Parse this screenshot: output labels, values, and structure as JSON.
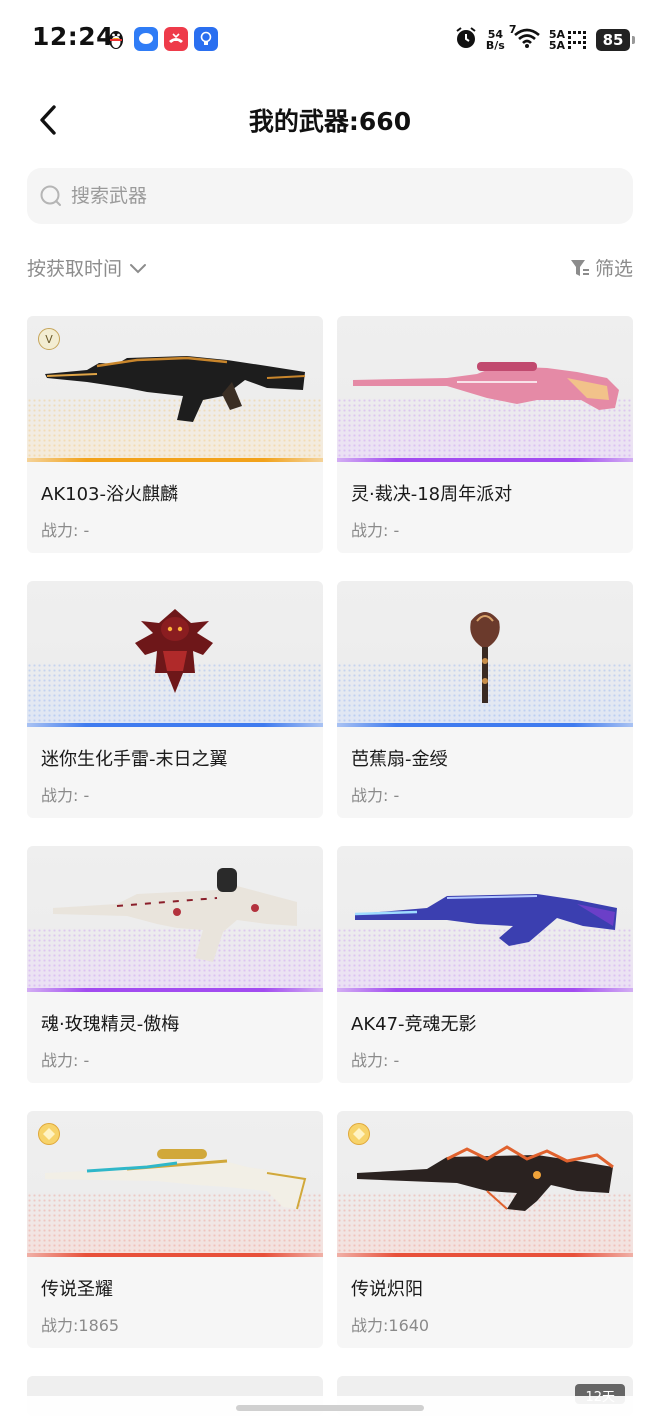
{
  "status_bar": {
    "time": "12:24",
    "net_speed_value": "54",
    "net_speed_unit": "B/s",
    "wifi_label": "7",
    "signal_top": "5A",
    "signal_bottom": "5A",
    "battery": "85"
  },
  "header": {
    "title": "我的武器:660"
  },
  "search": {
    "placeholder": "搜索武器"
  },
  "sort": {
    "label": "按获取时间"
  },
  "filter": {
    "label": "筛选"
  },
  "weapons": [
    {
      "name": "AK103-浴火麒麟",
      "power": "战力: -",
      "rarity_color": "#f2a21a",
      "badge": "V"
    },
    {
      "name": "灵·裁决-18周年派对",
      "power": "战力: -",
      "rarity_color": "#a24bf0"
    },
    {
      "name": "迷你生化手雷-末日之翼",
      "power": "战力: -",
      "rarity_color": "#3f7bef"
    },
    {
      "name": "芭蕉扇-金绶",
      "power": "战力: -",
      "rarity_color": "#3f7bef"
    },
    {
      "name": "魂·玫瑰精灵-傲梅",
      "power": "战力: -",
      "rarity_color": "#a24bf0"
    },
    {
      "name": "AK47-竞魂无影",
      "power": "战力: -",
      "rarity_color": "#a24bf0"
    },
    {
      "name": "传说圣耀",
      "power": "战力:1865",
      "rarity_color": "#e8503a",
      "badge": "gold"
    },
    {
      "name": "传说炽阳",
      "power": "战力:1640",
      "rarity_color": "#e8503a",
      "badge": "gold"
    }
  ],
  "partial_row": {
    "count_tag": "12天"
  }
}
